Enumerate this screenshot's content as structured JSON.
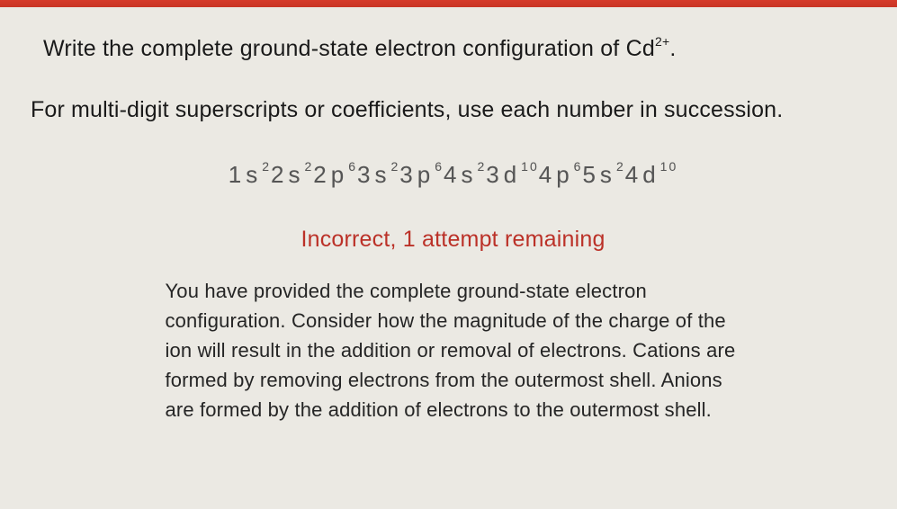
{
  "question": {
    "prefix": "Write the complete ground-state electron configuration of Cd",
    "super": "2+",
    "suffix": "."
  },
  "instruction": "For multi-digit superscripts or coefficients, use each number in succession.",
  "answer": {
    "segments": [
      {
        "base": "1s",
        "sup": "2"
      },
      {
        "base": "2s",
        "sup": "2"
      },
      {
        "base": "2p",
        "sup": "6"
      },
      {
        "base": "3s",
        "sup": "2"
      },
      {
        "base": "3p",
        "sup": "6"
      },
      {
        "base": "4s",
        "sup": "2"
      },
      {
        "base": "3d",
        "sup": "10"
      },
      {
        "base": "4p",
        "sup": "6"
      },
      {
        "base": "5s",
        "sup": "2"
      },
      {
        "base": "4d",
        "sup": "10"
      }
    ]
  },
  "feedback": {
    "status": "Incorrect, 1 attempt remaining",
    "text": "You have provided the complete ground-state electron configuration. Consider how the magnitude of the charge of the ion will result in the addition or removal of electrons. Cations are formed by removing electrons from the outermost shell. Anions are formed by the addition of electrons to the outermost shell."
  }
}
